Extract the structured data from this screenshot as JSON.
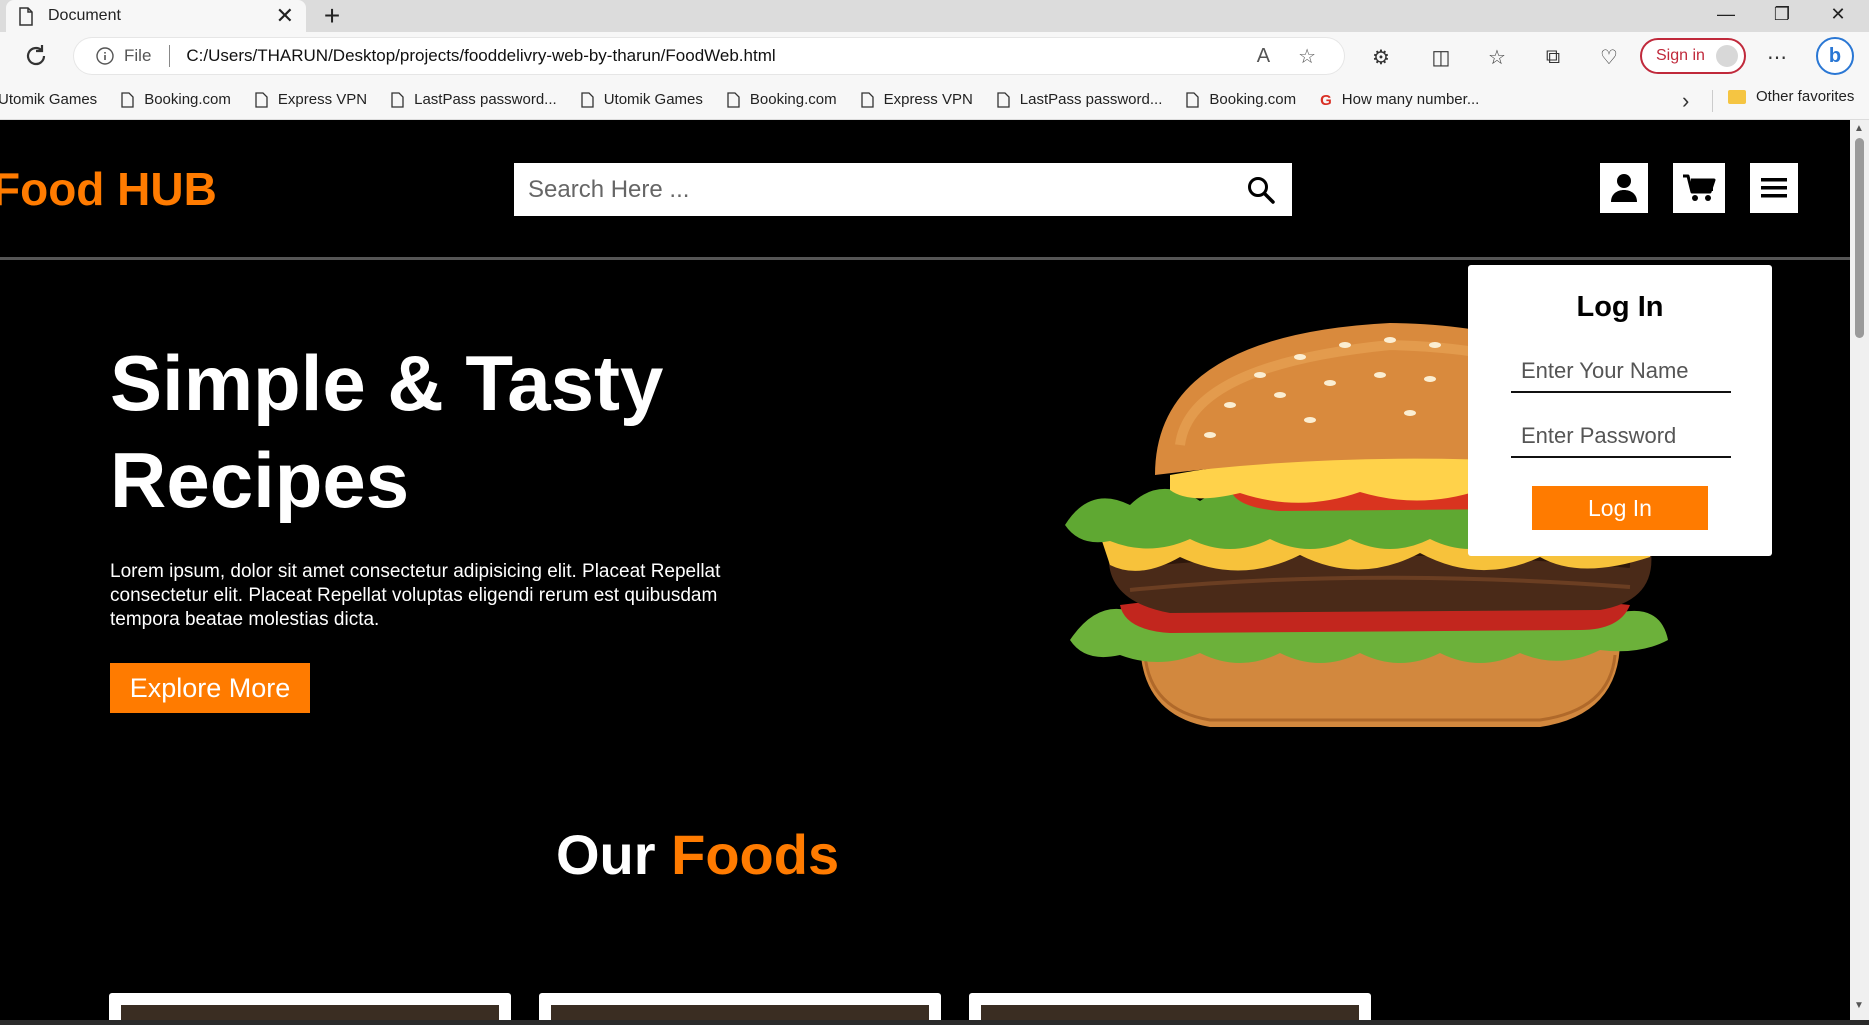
{
  "browser": {
    "tab_title": "Document",
    "tab_close": "✕",
    "new_tab": "+",
    "file_label": "File",
    "url": "C:/Users/THARUN/Desktop/projects/fooddelivry-web-by-tharun/FoodWeb.html",
    "sign_in": "Sign in",
    "favorites": [
      "Utomik Games",
      "Booking.com",
      "Express VPN",
      "LastPass password...",
      "Utomik Games",
      "Booking.com",
      "Express VPN",
      "LastPass password...",
      "Booking.com",
      "How many number..."
    ],
    "other_favorites": "Other favorites"
  },
  "header": {
    "logo": "Food HUB",
    "search_placeholder": "Search Here ..."
  },
  "hero": {
    "title": "Simple & Tasty Recipes",
    "description": "Lorem ipsum, dolor sit amet consectetur adipisicing elit. Placeat Repellat consectetur elit. Placeat Repellat voluptas eligendi rerum est quibusdam tempora beatae molestias dicta.",
    "button": "Explore More"
  },
  "login": {
    "title": "Log In",
    "name_placeholder": "Enter Your Name",
    "password_placeholder": "Enter Password",
    "button": "Log In"
  },
  "section": {
    "title_part1": "Our ",
    "title_part2": "Foods"
  },
  "colors": {
    "accent": "#ff7b00",
    "background": "#000000"
  }
}
